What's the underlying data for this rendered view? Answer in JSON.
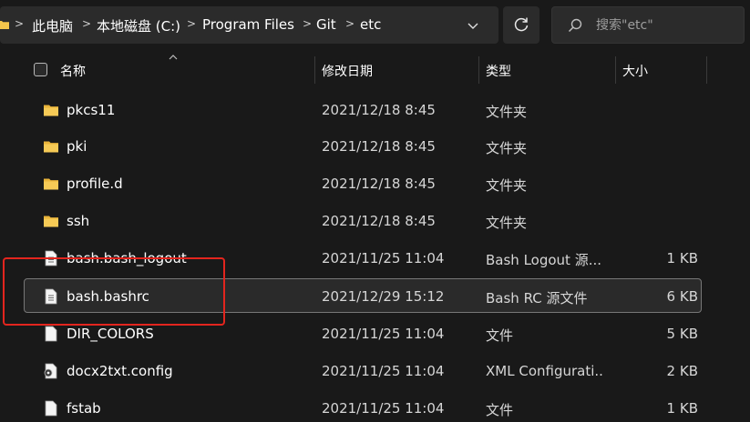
{
  "address_bar": {
    "crumbs": [
      "此电脑",
      "本地磁盘 (C:)",
      "Program Files",
      "Git",
      "etc"
    ],
    "separator": ">"
  },
  "search": {
    "placeholder": "搜索\"etc\""
  },
  "columns": {
    "name": "名称",
    "date": "修改日期",
    "type": "类型",
    "size": "大小"
  },
  "files": [
    {
      "name": "pkcs11",
      "date": "2021/12/18 8:45",
      "type": "文件夹",
      "size": "",
      "icon": "folder-icon"
    },
    {
      "name": "pki",
      "date": "2021/12/18 8:45",
      "type": "文件夹",
      "size": "",
      "icon": "folder-icon"
    },
    {
      "name": "profile.d",
      "date": "2021/12/18 8:45",
      "type": "文件夹",
      "size": "",
      "icon": "folder-icon"
    },
    {
      "name": "ssh",
      "date": "2021/12/18 8:45",
      "type": "文件夹",
      "size": "",
      "icon": "folder-icon"
    },
    {
      "name": "bash.bash_logout",
      "date": "2021/11/25 11:04",
      "type": "Bash Logout 源...",
      "size": "1 KB",
      "icon": "text-file-icon"
    },
    {
      "name": "bash.bashrc",
      "date": "2021/12/29 15:12",
      "type": "Bash RC 源文件",
      "size": "6 KB",
      "icon": "text-file-icon"
    },
    {
      "name": "DIR_COLORS",
      "date": "2021/11/25 11:04",
      "type": "文件",
      "size": "5 KB",
      "icon": "blank-file-icon"
    },
    {
      "name": "docx2txt.config",
      "date": "2021/11/25 11:04",
      "type": "XML Configurati...",
      "size": "2 KB",
      "icon": "config-file-icon"
    },
    {
      "name": "fstab",
      "date": "2021/11/25 11:04",
      "type": "文件",
      "size": "1 KB",
      "icon": "blank-file-icon"
    }
  ],
  "colors": {
    "background": "#191919",
    "bar": "#2b2b2b",
    "folder": "#f3c54c",
    "annotation": "#e3251e"
  }
}
